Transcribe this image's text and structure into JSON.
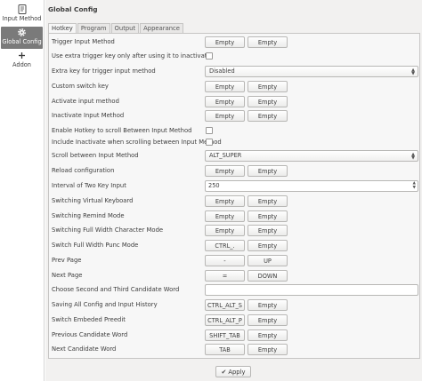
{
  "sidebar": {
    "items": [
      {
        "label": "Input Method",
        "icon": "input-method-icon"
      },
      {
        "label": "Global Config",
        "icon": "gear-icon"
      },
      {
        "label": "Addon",
        "icon": "plus-icon"
      }
    ]
  },
  "page": {
    "title": "Global Config"
  },
  "tabs": [
    "Hotkey",
    "Program",
    "Output",
    "Appearance"
  ],
  "settings": {
    "trigger": {
      "label": "Trigger Input Method",
      "b1": "Empty",
      "b2": "Empty"
    },
    "extra_only": {
      "label": "Use extra trigger key only after using it to inactivate"
    },
    "extra_key": {
      "label": "Extra key for trigger input method",
      "value": "Disabled"
    },
    "custom_switch": {
      "label": "Custom switch key",
      "b1": "Empty",
      "b2": "Empty"
    },
    "activate": {
      "label": "Activate input method",
      "b1": "Empty",
      "b2": "Empty"
    },
    "inactivate": {
      "label": "Inactivate Input Method",
      "b1": "Empty",
      "b2": "Empty"
    },
    "enable_scroll": {
      "label": "Enable Hotkey to scroll Between Input Method"
    },
    "include_inactivate": {
      "label": "Include Inactivate when scrolling between Input Method"
    },
    "scroll_between": {
      "label": "Scroll between Input Method",
      "value": "ALT_SUPER"
    },
    "reload": {
      "label": "Reload configuration",
      "b1": "Empty",
      "b2": "Empty"
    },
    "interval": {
      "label": "Interval of Two Key Input",
      "value": "250"
    },
    "virtual_kb": {
      "label": "Switching Virtual Keyboard",
      "b1": "Empty",
      "b2": "Empty"
    },
    "remind": {
      "label": "Switching Remind Mode",
      "b1": "Empty",
      "b2": "Empty"
    },
    "full_width_char": {
      "label": "Switching Full Width Character Mode",
      "b1": "Empty",
      "b2": "Empty"
    },
    "full_width_punc": {
      "label": "Switch Full Width Punc Mode",
      "b1": "CTRL_.",
      "b2": "Empty"
    },
    "prev_page": {
      "label": "Prev Page",
      "b1": "-",
      "b2": "UP"
    },
    "next_page": {
      "label": "Next Page",
      "b1": "=",
      "b2": "DOWN"
    },
    "choose_candidate": {
      "label": "Choose Second and Third Candidate Word",
      "value": ""
    },
    "save_all": {
      "label": "Saving All Config and Input History",
      "b1": "CTRL_ALT_S",
      "b2": "Empty"
    },
    "embedded_preedit": {
      "label": "Switch Embeded Preedit",
      "b1": "CTRL_ALT_P",
      "b2": "Empty"
    },
    "prev_candidate": {
      "label": "Previous Candidate Word",
      "b1": "SHIFT_TAB",
      "b2": "Empty"
    },
    "next_candidate": {
      "label": "Next Candidate Word",
      "b1": "TAB",
      "b2": "Empty"
    }
  },
  "footer": {
    "apply_label": "Apply"
  },
  "colors": {
    "sidebar_selected": "#7a7a7a",
    "window_bg": "#f2f1f0",
    "panel_bg": "#f7f7f7"
  }
}
